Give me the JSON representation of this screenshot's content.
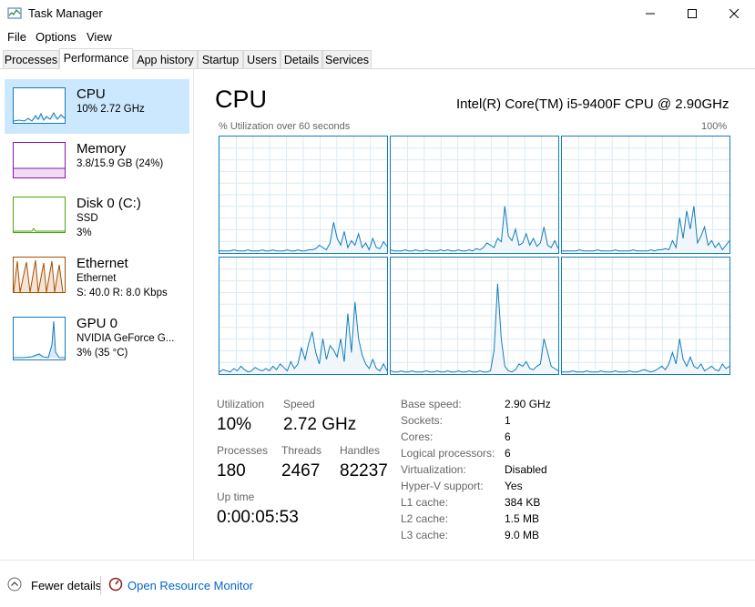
{
  "window": {
    "title": "Task Manager"
  },
  "menu": [
    "File",
    "Options",
    "View"
  ],
  "tabs": [
    "Processes",
    "Performance",
    "App history",
    "Startup",
    "Users",
    "Details",
    "Services"
  ],
  "active_tab": "Performance",
  "sidebar": {
    "items": [
      {
        "title": "CPU",
        "line1": "10% 2.72 GHz",
        "line2": "",
        "line3": "",
        "color": "#117dbb",
        "selected": true
      },
      {
        "title": "Memory",
        "line1": "3.8/15.9 GB (24%)",
        "line2": "",
        "line3": "",
        "color": "#8b12ae",
        "selected": false
      },
      {
        "title": "Disk 0 (C:)",
        "line1": "SSD",
        "line2": "3%",
        "line3": "",
        "color": "#4da60c",
        "selected": false
      },
      {
        "title": "Ethernet",
        "line1": "Ethernet",
        "line2": "S: 40.0 R: 8.0 Kbps",
        "line3": "",
        "color": "#a74f01",
        "selected": false
      },
      {
        "title": "GPU 0",
        "line1": "NVIDIA GeForce G...",
        "line2": "3% (35 °C)",
        "line3": "",
        "color": "#117dbb",
        "selected": false
      }
    ]
  },
  "main": {
    "heading": "CPU",
    "model": "Intel(R) Core(TM) i5-9400F CPU @ 2.90GHz",
    "graph_label": "% Utilization over 60 seconds",
    "max_label": "100%",
    "accent": "#117dbb",
    "stats": {
      "utilization_label": "Utilization",
      "utilization": "10%",
      "speed_label": "Speed",
      "speed": "2.72 GHz",
      "processes_label": "Processes",
      "processes": "180",
      "threads_label": "Threads",
      "threads": "2467",
      "handles_label": "Handles",
      "handles": "82237",
      "uptime_label": "Up time",
      "uptime": "0:00:05:53"
    },
    "specs": [
      {
        "label": "Base speed:",
        "value": "2.90 GHz"
      },
      {
        "label": "Sockets:",
        "value": "1"
      },
      {
        "label": "Cores:",
        "value": "6"
      },
      {
        "label": "Logical processors:",
        "value": "6"
      },
      {
        "label": "Virtualization:",
        "value": "Disabled"
      },
      {
        "label": "Hyper-V support:",
        "value": "Yes"
      },
      {
        "label": "L1 cache:",
        "value": "384 KB"
      },
      {
        "label": "L2 cache:",
        "value": "1.5 MB"
      },
      {
        "label": "L3 cache:",
        "value": "9.0 MB"
      }
    ]
  },
  "footer": {
    "fewer_details": "Fewer details",
    "resource_monitor": "Open Resource Monitor"
  }
}
